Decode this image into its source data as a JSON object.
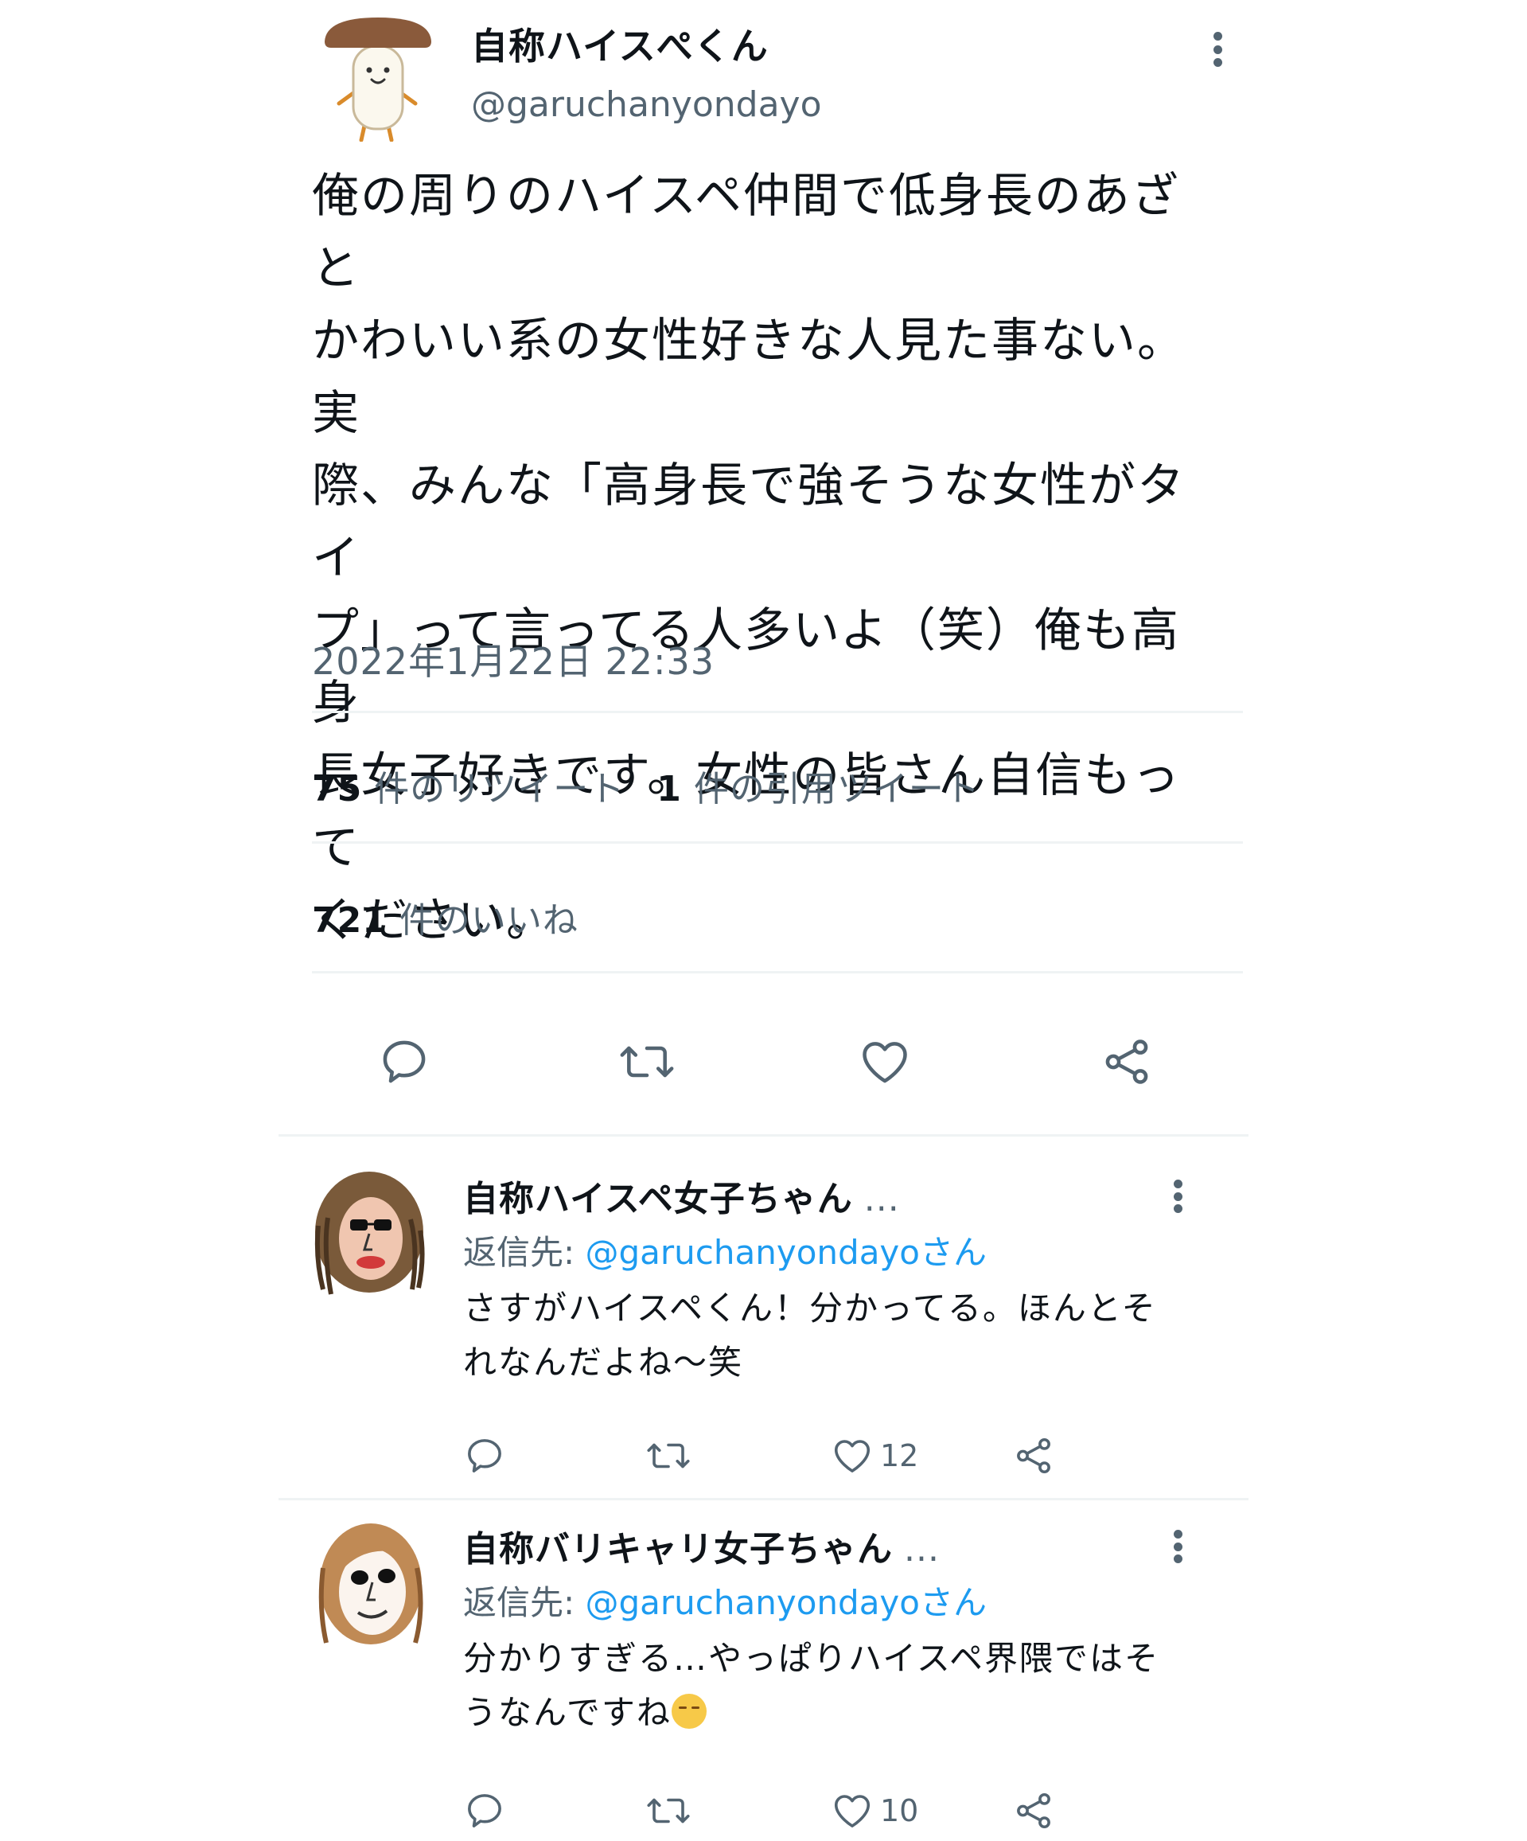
{
  "main_tweet": {
    "display_name": "自称ハイスぺくん",
    "handle": "@garuchanyondayo",
    "body": "俺の周りのハイスペ仲間で低身長のあざと\nかわいい系の女性好きな人見た事ない。実\n際、みんな「高身長で強そうな女性がタイ\nプ」って言ってる人多いよ（笑）俺も高身\n長女子好きです。女性の皆さん自信もって\nください。",
    "timestamp": "2022年1月22日 22:33",
    "retweets_count": "75",
    "retweets_label": "件のリツイート",
    "quotes_count": "1",
    "quotes_label": "件の引用ツイート",
    "likes_count": "721",
    "likes_label": "件のいいね"
  },
  "replies": [
    {
      "display_name": "自称ハイスペ女子ちゃん",
      "ellipsis": "...",
      "reply_prefix": "返信先: ",
      "reply_to": "@garuchanyondayoさん",
      "body": "さすがハイスペくん！分かってる。ほんとそ\nれなんだよね〜笑",
      "like_count": "12"
    },
    {
      "display_name": "自称バリキャリ女子ちゃん",
      "ellipsis": "...",
      "reply_prefix": "返信先: ",
      "reply_to": "@garuchanyondayoさん",
      "body": "分かりすぎる…やっぱりハイスペ界隈ではそ\nうなんですね",
      "emoji": "relieved-face",
      "like_count": "10"
    }
  ],
  "colors": {
    "text": "#0f1419",
    "secondary": "#536471",
    "link": "#1d9bf0",
    "divider": "#eff3f4"
  }
}
